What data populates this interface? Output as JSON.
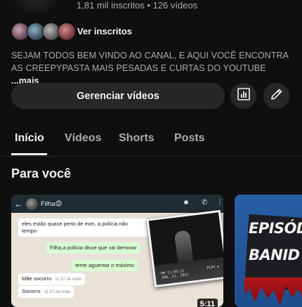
{
  "channel": {
    "stats": "1,81 mil inscritos • 126 vídeos",
    "subscribers_link": "Ver inscritos",
    "description": "SEJAM TODOS BEM VINDO AO CANAL, E AQUI  VOCÊ ENCONTRA AS CREEPYPASTA MAIS PESADAS E CURTAS DO YOUTUBE ",
    "more_label": "...mais"
  },
  "actions": {
    "manage_label": "Gerenciar vídeos",
    "stats_icon": "analytics-icon",
    "edit_icon": "pencil-icon"
  },
  "tabs": [
    {
      "label": "Início",
      "active": true
    },
    {
      "label": "Vídeos",
      "active": false
    },
    {
      "label": "Shorts",
      "active": false
    },
    {
      "label": "Posts",
      "active": false
    }
  ],
  "section": {
    "title": "Para você"
  },
  "videos": [
    {
      "duration": "5:11",
      "thumbnail": {
        "contact_name": "Filha😡",
        "messages": [
          {
            "text": "eles estão quase perto de mim, a polícia não",
            "text2": "tempo",
            "time": ""
          },
          {
            "text": "Filha,a polícia disse que vai demorar",
            "time": ""
          },
          {
            "text": "tente aguentar o máximo",
            "time": ""
          },
          {
            "text": "Mãe socorro",
            "time": "11:57 da noite"
          },
          {
            "text": "Socorro",
            "time": "11:57 da noite"
          }
        ],
        "cctv_line1": "PM 11:56:21",
        "cctv_line2": "JUN. 21. 2011",
        "cctv_tag": "PLAY ►"
      }
    },
    {
      "thumbnail": {
        "line1": "EPISÓD",
        "line2": "BANID"
      }
    }
  ],
  "colors": {
    "background": "#0f0f0f",
    "button": "#272727",
    "text_primary": "#f1f1f1",
    "text_secondary": "#aaaaaa"
  }
}
